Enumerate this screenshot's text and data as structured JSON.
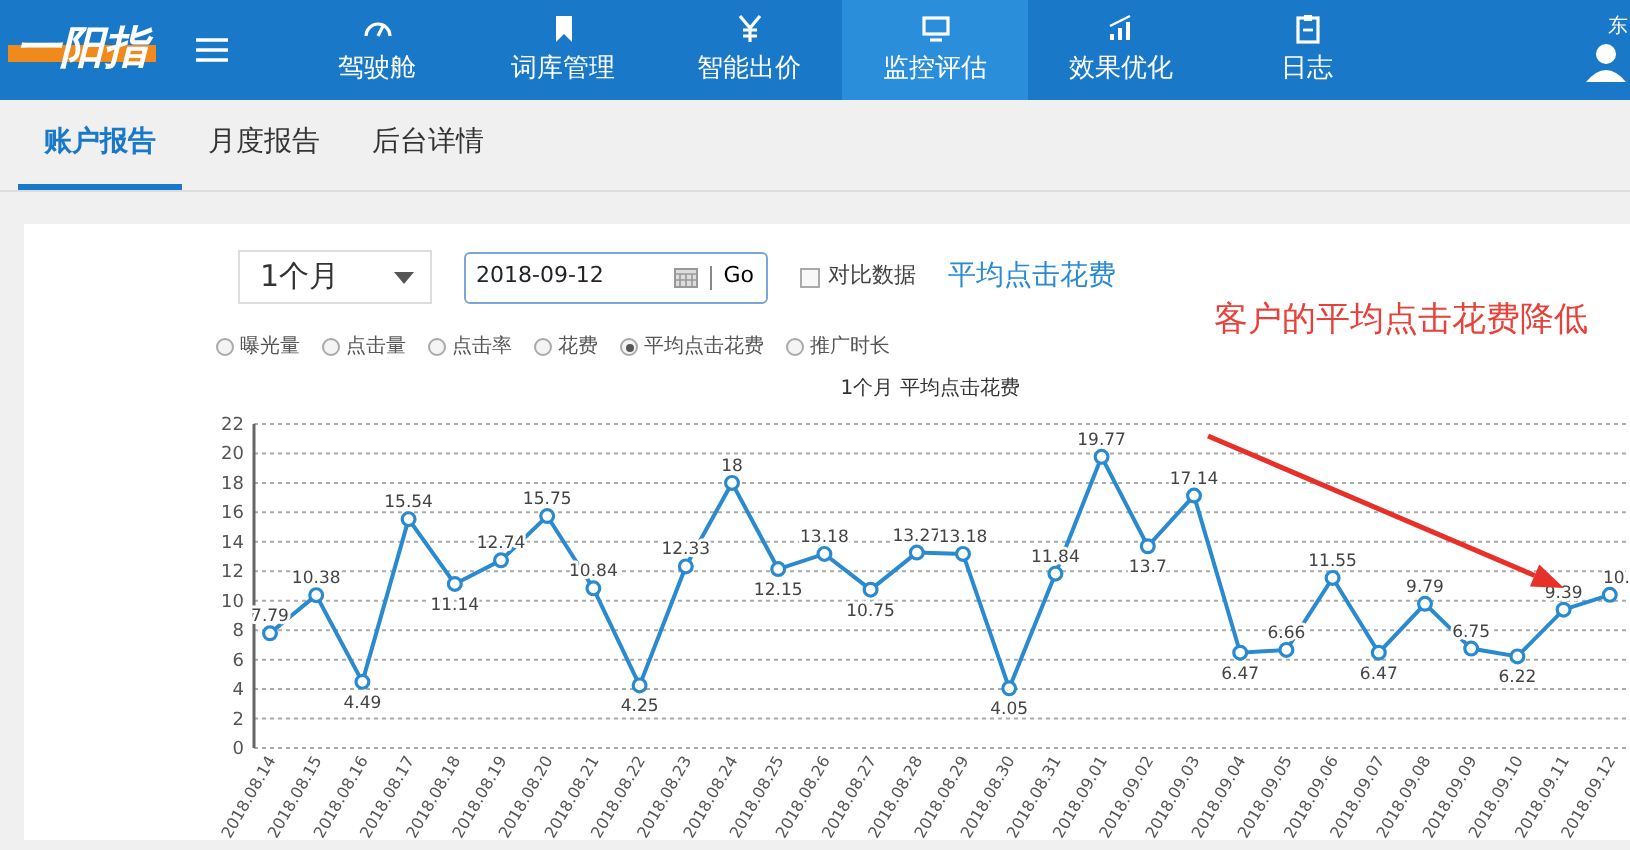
{
  "logo": {
    "text": "一阳指"
  },
  "nav": [
    {
      "label": "驾驶舱",
      "selected": false
    },
    {
      "label": "词库管理",
      "selected": false
    },
    {
      "label": "智能出价",
      "selected": false
    },
    {
      "label": "监控评估",
      "selected": true
    },
    {
      "label": "效果优化",
      "selected": false
    },
    {
      "label": "日志",
      "selected": false
    }
  ],
  "user": {
    "name": "东"
  },
  "tabs": [
    {
      "label": "账户报告",
      "selected": true
    },
    {
      "label": "月度报告",
      "selected": false
    },
    {
      "label": "后台详情",
      "selected": false
    }
  ],
  "filters": {
    "period": "1个月",
    "date": "2018-09-12",
    "go": "Go",
    "compare": {
      "label": "对比数据",
      "checked": false
    },
    "metric_link": "平均点击花费"
  },
  "metrics": [
    {
      "label": "曝光量",
      "selected": false
    },
    {
      "label": "点击量",
      "selected": false
    },
    {
      "label": "点击率",
      "selected": false
    },
    {
      "label": "花费",
      "selected": false
    },
    {
      "label": "平均点击花费",
      "selected": true
    },
    {
      "label": "推广时长",
      "selected": false
    }
  ],
  "annotation": "客户的平均点击花费降低",
  "chart_data": {
    "type": "line",
    "title": "1个月  平均点击花费",
    "categories": [
      "2018.08.14",
      "2018.08.15",
      "2018.08.16",
      "2018.08.17",
      "2018.08.18",
      "2018.08.19",
      "2018.08.20",
      "2018.08.21",
      "2018.08.22",
      "2018.08.23",
      "2018.08.24",
      "2018.08.25",
      "2018.08.26",
      "2018.08.27",
      "2018.08.28",
      "2018.08.29",
      "2018.08.30",
      "2018.08.31",
      "2018.09.01",
      "2018.09.02",
      "2018.09.03",
      "2018.09.04",
      "2018.09.05",
      "2018.09.06",
      "2018.09.07",
      "2018.09.08",
      "2018.09.09",
      "2018.09.10",
      "2018.09.11",
      "2018.09.12"
    ],
    "grid": true,
    "series": [
      {
        "color": "#2a8ad0",
        "marker": true,
        "values": [
          7.79,
          10.38,
          4.49,
          15.54,
          11.14,
          12.74,
          15.75,
          10.84,
          4.25,
          12.33,
          18,
          12.15,
          13.18,
          10.75,
          13.27,
          13.18,
          4.05,
          11.84,
          19.77,
          13.7,
          17.14,
          6.47,
          6.66,
          11.55,
          6.47,
          9.79,
          6.75,
          6.22,
          9.39,
          10.4
        ]
      }
    ],
    "value_labels": [
      "7.79",
      "10.38",
      "4.49",
      "15.54",
      "11.14",
      "12.74",
      "15.75",
      "10.84",
      "4.25",
      "12.33",
      "18",
      "12.15",
      "13.18",
      "10.75",
      "13.27",
      "13.18",
      "4.05",
      "11.84",
      "19.77",
      "13.7",
      "17.14",
      "6.47",
      "6.66",
      "11.55",
      "6.47",
      "9.79",
      "6.75",
      "6.22",
      "9.39",
      "10."
    ],
    "ylim": [
      0,
      22
    ],
    "yticks": [
      0,
      2,
      4,
      6,
      8,
      10,
      12,
      14,
      16,
      18,
      20,
      22
    ]
  }
}
